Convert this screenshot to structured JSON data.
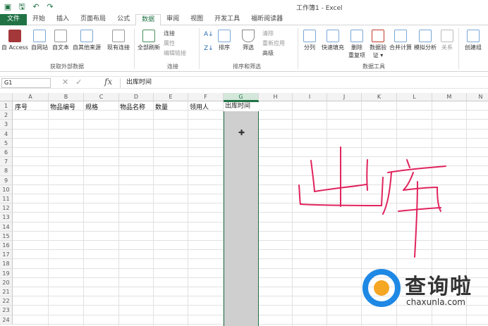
{
  "window": {
    "title": "工作簿1 - Excel"
  },
  "tabs": [
    {
      "label": "文件"
    },
    {
      "label": "开始"
    },
    {
      "label": "插入"
    },
    {
      "label": "页面布局"
    },
    {
      "label": "公式"
    },
    {
      "label": "数据"
    },
    {
      "label": "审阅"
    },
    {
      "label": "视图"
    },
    {
      "label": "开发工具"
    },
    {
      "label": "福昕阅读器"
    }
  ],
  "ribbon": {
    "get_external": {
      "access": "自 Access",
      "web": "自网站",
      "text": "自文本",
      "other": "自其他来源",
      "existing": "现有连接",
      "group_label": "获取外部数据"
    },
    "connections": {
      "refresh_all": "全部刷新",
      "connections": "连接",
      "properties": "属性",
      "edit_links": "编辑链接",
      "group_label": "连接"
    },
    "sort_filter": {
      "sort": "排序",
      "filter": "筛选",
      "clear": "清除",
      "reapply": "重新应用",
      "advanced": "高级",
      "group_label": "排序和筛选"
    },
    "data_tools": {
      "text_to_columns": "分列",
      "flash_fill": "快速填充",
      "remove_dup_1": "删除",
      "remove_dup_2": "重复项",
      "validation_1": "数据验",
      "validation_2": "证 ▾",
      "consolidate": "合并计算",
      "what_if": "模拟分析",
      "relationships": "关系",
      "group_label": "数据工具"
    },
    "outline": {
      "group": "创建组"
    }
  },
  "formula_bar": {
    "name_box": "G1",
    "formula": "出库时间"
  },
  "grid": {
    "columns": [
      "A",
      "B",
      "C",
      "D",
      "E",
      "F",
      "G",
      "H",
      "I",
      "J",
      "K",
      "L",
      "M",
      "N"
    ],
    "rows": [
      "1",
      "2",
      "3",
      "4",
      "5",
      "6",
      "7",
      "8",
      "9",
      "10",
      "11",
      "12",
      "13",
      "14",
      "15",
      "16",
      "17",
      "18",
      "19",
      "20",
      "21",
      "22",
      "23",
      "24"
    ],
    "row1": [
      "序号",
      "物品编号",
      "规格",
      "物品名称",
      "数量",
      "领用人",
      "出库时间"
    ]
  },
  "handwriting": {
    "text": "出库"
  },
  "watermark": {
    "cn": "查询啦",
    "url": "chaxunla.com"
  },
  "colors": {
    "excel_green": "#217346",
    "handwriting": "#e0245e",
    "logo_blue": "#1e88e5",
    "logo_orange": "#f5a623"
  }
}
